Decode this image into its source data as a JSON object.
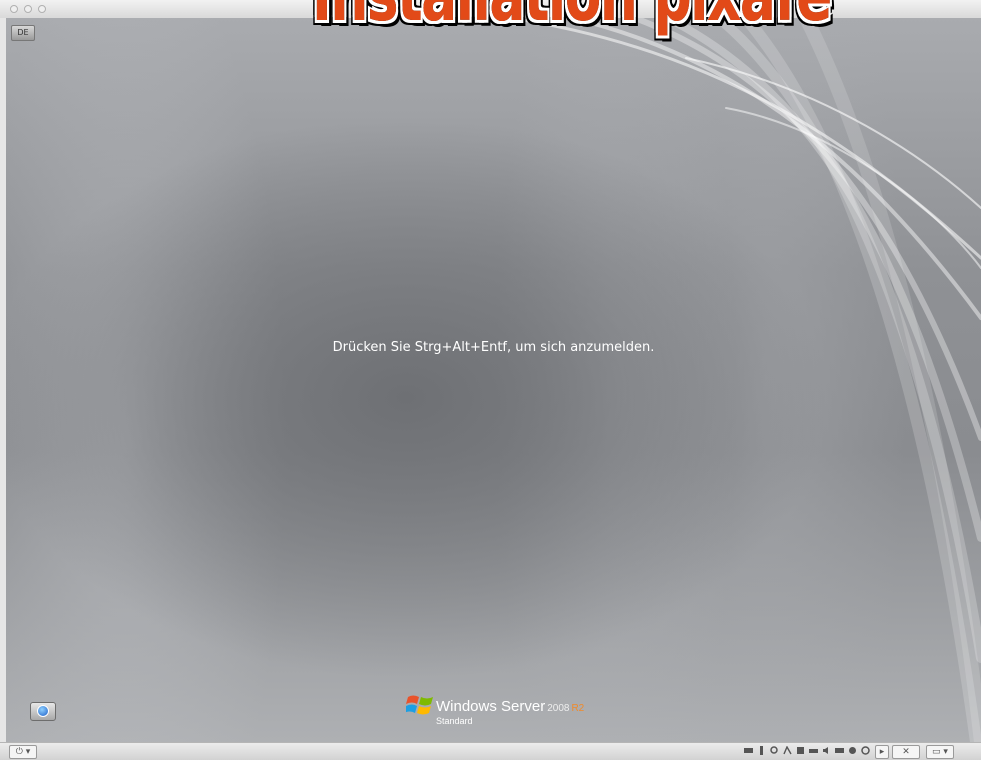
{
  "window": {
    "language_indicator": "DE",
    "overlay_title": "Installation pixafe"
  },
  "login": {
    "prompt": "Drücken Sie Strg+Alt+Entf, um sich anzumelden."
  },
  "branding": {
    "product": "Windows Server",
    "version": "2008",
    "release": "R2",
    "edition": "Standard"
  },
  "statusbar": {
    "power_label": "⏻ ▾",
    "tray_icons": [
      "keyboard-icon",
      "usb-icon",
      "search-icon",
      "network-icon",
      "floppy-icon",
      "printer-icon",
      "audio-icon",
      "display-icon",
      "camera-icon",
      "disk-icon",
      "play-icon",
      "tools-icon",
      "window-icon"
    ]
  },
  "colors": {
    "overlay_title": "#e24a18",
    "release_accent": "#f08a2a",
    "login_text": "#ffffff"
  }
}
